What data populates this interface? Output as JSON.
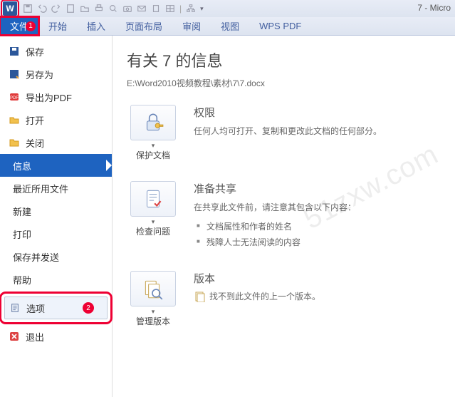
{
  "titlebar": {
    "doc_title": "7 - Micro"
  },
  "ribbon": {
    "file": "文件",
    "file_badge": "1",
    "tabs": [
      "开始",
      "插入",
      "页面布局",
      "审阅",
      "视图",
      "WPS PDF"
    ]
  },
  "sidebar": {
    "save": "保存",
    "saveas": "另存为",
    "export_pdf": "导出为PDF",
    "open": "打开",
    "close": "关闭",
    "info": "信息",
    "recent": "最近所用文件",
    "new": "新建",
    "print": "打印",
    "send": "保存并发送",
    "help": "帮助",
    "options": "选项",
    "options_badge": "2",
    "exit": "退出"
  },
  "info": {
    "heading": "有关 7 的信息",
    "path": "E:\\Word2010视频教程\\素材\\7\\7.docx",
    "protect_btn": "保护文档",
    "perm_title": "权限",
    "perm_desc": "任何人均可打开、复制和更改此文档的任何部分。",
    "check_btn": "检查问题",
    "share_title": "准备共享",
    "share_desc": "在共享此文件前，请注意其包含以下内容：",
    "share_b1": "文档属性和作者的姓名",
    "share_b2": "残障人士无法阅读的内容",
    "versions_btn": "管理版本",
    "ver_title": "版本",
    "ver_desc": "找不到此文件的上一个版本。"
  },
  "watermark": "51zxw.com"
}
